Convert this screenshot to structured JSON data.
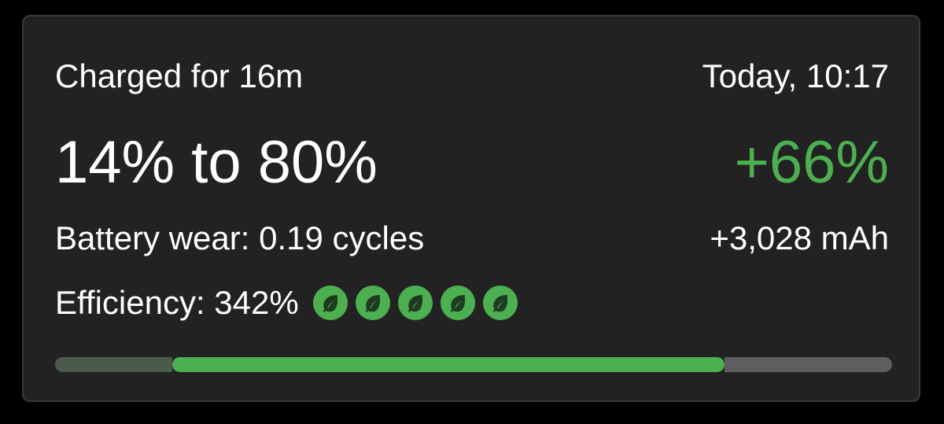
{
  "charge_card": {
    "duration_label": "Charged for 16m",
    "timestamp": "Today, 10:17",
    "range_label": "14% to 80%",
    "delta_percent": "+66%",
    "wear_label": "Battery wear: 0.19 cycles",
    "capacity_added": "+3,028 mAh",
    "efficiency_label": "Efficiency: 342%",
    "leaf_rating": 5,
    "leaf_icon": "leaf-icon",
    "progress": {
      "start_percent": 14,
      "end_percent": 80
    }
  },
  "colors": {
    "accent_green": "#4caf50",
    "filled_before": "#4a5a4b",
    "track_remaining": "#5e5e5e",
    "leaf_glyph": "#1e3a1f"
  }
}
